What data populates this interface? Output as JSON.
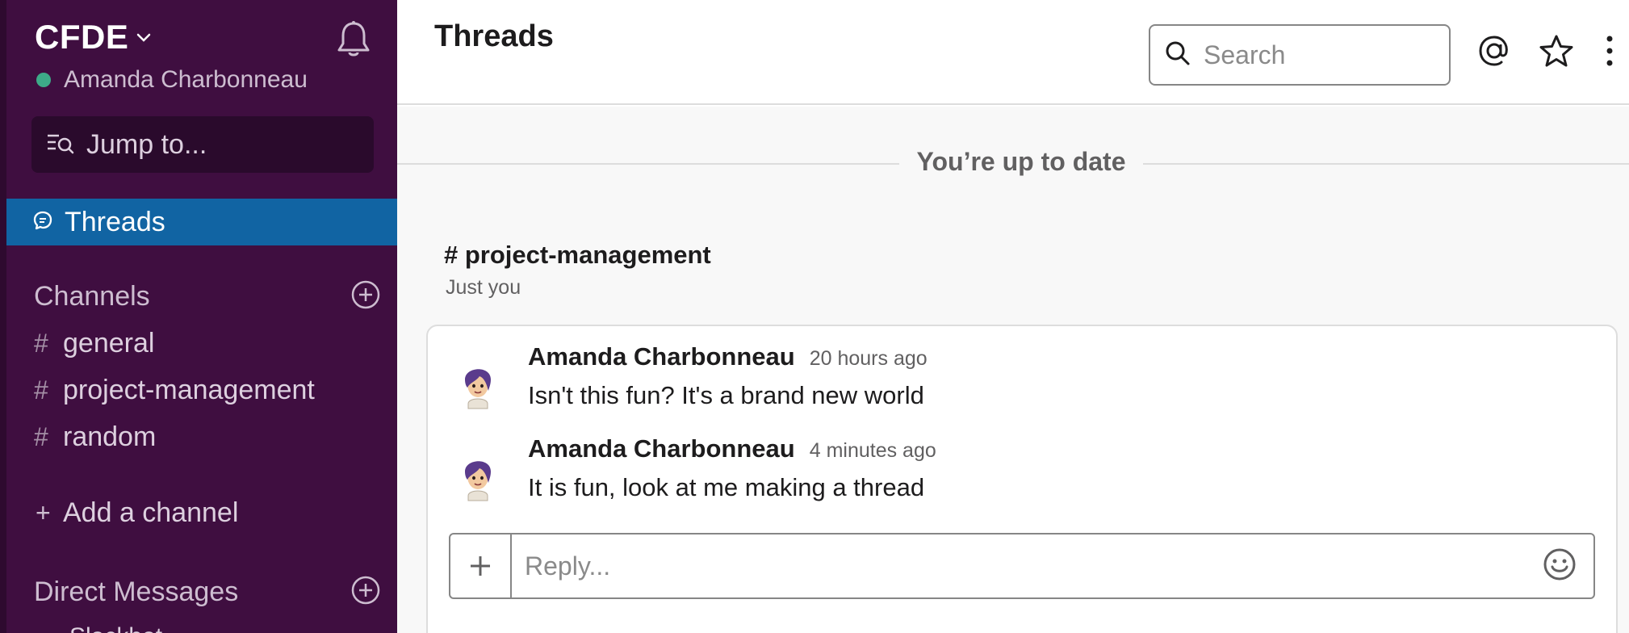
{
  "sidebar": {
    "team_name": "CFDE",
    "user_name": "Amanda Charbonneau",
    "jump_to": "Jump to...",
    "threads_label": "Threads",
    "channels_header": "Channels",
    "channels": [
      {
        "name": "general"
      },
      {
        "name": "project-management"
      },
      {
        "name": "random"
      }
    ],
    "channel_prefix": "#",
    "add_channel_plus": "+",
    "add_channel": "Add a channel",
    "dm_header": "Direct Messages",
    "dm_peek": "Slackbot"
  },
  "header": {
    "title": "Threads",
    "search_placeholder": "Search"
  },
  "main": {
    "up_to_date": "You’re up to date",
    "thread": {
      "channel": "# project-management",
      "subtitle": "Just you",
      "messages": [
        {
          "author": "Amanda Charbonneau",
          "time": "20 hours ago",
          "text": "Isn't this fun? It's a brand new world"
        },
        {
          "author": "Amanda Charbonneau",
          "time": "4 minutes ago",
          "text": "It is fun, look at me making a thread"
        }
      ],
      "reply_placeholder": "Reply..."
    }
  },
  "colors": {
    "sidebar_bg": "#3F0E40",
    "active_item": "#1164A3",
    "presence": "#3DAA88"
  },
  "icons": [
    "chevron-down-icon",
    "bell-icon",
    "jump-to-icon",
    "threads-icon",
    "add-circle-icon",
    "search-icon",
    "at-icon",
    "star-icon",
    "more-vertical-icon",
    "avatar",
    "plus-icon",
    "emoji-icon"
  ]
}
